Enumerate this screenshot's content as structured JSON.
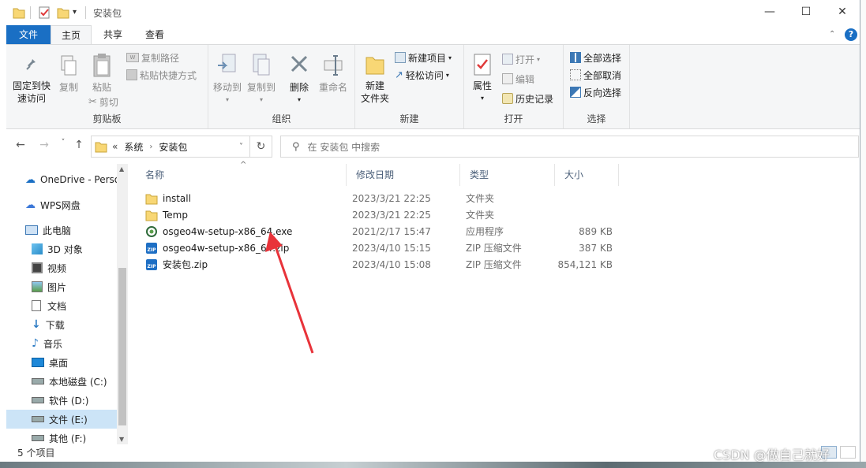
{
  "window": {
    "title": "安装包"
  },
  "tabs": [
    "文件",
    "主页",
    "共享",
    "查看"
  ],
  "ribbon": {
    "clipboard": {
      "label": "剪贴板",
      "pin": "固定到快\n速访问",
      "copy": "复制",
      "paste": "粘贴",
      "copy_path": "复制路径",
      "paste_shortcut": "粘贴快捷方式",
      "cut": "剪切"
    },
    "organize": {
      "label": "组织",
      "move_to": "移动到",
      "copy_to": "复制到",
      "delete": "删除",
      "rename": "重命名"
    },
    "new": {
      "label": "新建",
      "new_folder": "新建\n文件夹",
      "new_item": "新建项目",
      "easy_access": "轻松访问"
    },
    "open": {
      "label": "打开",
      "properties": "属性",
      "open": "打开",
      "edit": "编辑",
      "history": "历史记录"
    },
    "select": {
      "label": "选择",
      "select_all": "全部选择",
      "select_none": "全部取消",
      "invert": "反向选择"
    }
  },
  "address": {
    "prefix": "«",
    "crumbs": [
      "系统",
      "安装包"
    ],
    "search_placeholder": "在 安装包 中搜索"
  },
  "nav": [
    {
      "label": "OneDrive - Perso",
      "icon": "cloud-icon"
    },
    {
      "label": "WPS网盘",
      "icon": "wps-cloud-icon"
    },
    {
      "label": "此电脑",
      "icon": "computer-icon"
    },
    {
      "label": "3D 对象",
      "icon": "cube-icon"
    },
    {
      "label": "视频",
      "icon": "video-icon"
    },
    {
      "label": "图片",
      "icon": "picture-icon"
    },
    {
      "label": "文档",
      "icon": "document-icon"
    },
    {
      "label": "下载",
      "icon": "download-icon"
    },
    {
      "label": "音乐",
      "icon": "music-icon"
    },
    {
      "label": "桌面",
      "icon": "desktop-icon"
    },
    {
      "label": "本地磁盘 (C:)",
      "icon": "drive-icon"
    },
    {
      "label": "软件 (D:)",
      "icon": "drive-icon"
    },
    {
      "label": "文件 (E:)",
      "icon": "drive-icon"
    },
    {
      "label": "其他 (F:)",
      "icon": "drive-icon"
    }
  ],
  "columns": [
    "名称",
    "修改日期",
    "类型",
    "大小"
  ],
  "files": [
    {
      "name": "install",
      "date": "2023/3/21 22:25",
      "type": "文件夹",
      "size": "",
      "icon": "folder-icon"
    },
    {
      "name": "Temp",
      "date": "2023/3/21 22:25",
      "type": "文件夹",
      "size": "",
      "icon": "folder-icon"
    },
    {
      "name": "osgeo4w-setup-x86_64.exe",
      "date": "2021/2/17 15:47",
      "type": "应用程序",
      "size": "889 KB",
      "icon": "osgeo-app-icon"
    },
    {
      "name": "osgeo4w-setup-x86_64.zip",
      "date": "2023/4/10 15:15",
      "type": "ZIP 压缩文件",
      "size": "387 KB",
      "icon": "zip-icon"
    },
    {
      "name": "安装包.zip",
      "date": "2023/4/10 15:08",
      "type": "ZIP 压缩文件",
      "size": "854,121 KB",
      "icon": "zip-icon"
    }
  ],
  "status": "5 个项目",
  "watermark": "CSDN @做自己就好",
  "colors": {
    "accent": "#1a6fc4",
    "arrow": "#e8333a",
    "folder": "#f8d775"
  }
}
